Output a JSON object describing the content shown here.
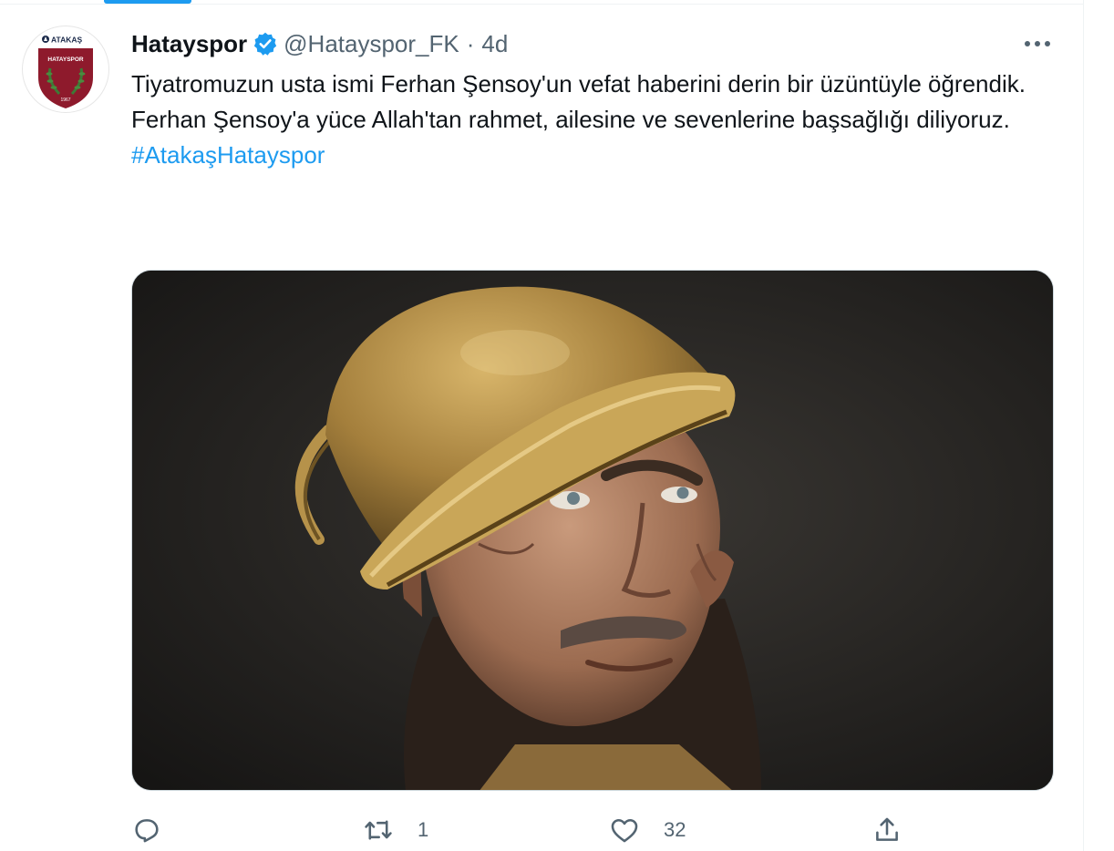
{
  "tweet": {
    "author": {
      "display_name": "Hatayspor",
      "handle": "@Hatayspor_FK",
      "verified": true,
      "avatar": {
        "sponsor_text": "ATAKAŞ",
        "club_text": "HATAYSPOR",
        "year_text": "1967"
      }
    },
    "separator": "·",
    "time": "4d",
    "text_lines": [
      "Tiyatromuzun usta ismi Ferhan Şensoy'un vefat haberini derin bir üzüntüyle öğrendik.",
      "Ferhan Şensoy'a yüce Allah'tan rahmet, ailesine ve sevenlerine başsağlığı diliyoruz."
    ],
    "hashtag": "#AtakaşHatayspor",
    "media": {
      "kind": "photo",
      "subject": "portrait of a man wearing a brass pot as a hat"
    },
    "actions": {
      "reply": {
        "icon": "reply-icon",
        "count": ""
      },
      "retweet": {
        "icon": "retweet-icon",
        "count": "1"
      },
      "like": {
        "icon": "heart-icon",
        "count": "32"
      },
      "share": {
        "icon": "share-icon",
        "count": ""
      }
    }
  },
  "colors": {
    "link": "#1d9bf0",
    "secondary_text": "#536471",
    "primary_text": "#0f1419",
    "club_maroon": "#8e1a2c",
    "divider": "#eff3f4"
  }
}
